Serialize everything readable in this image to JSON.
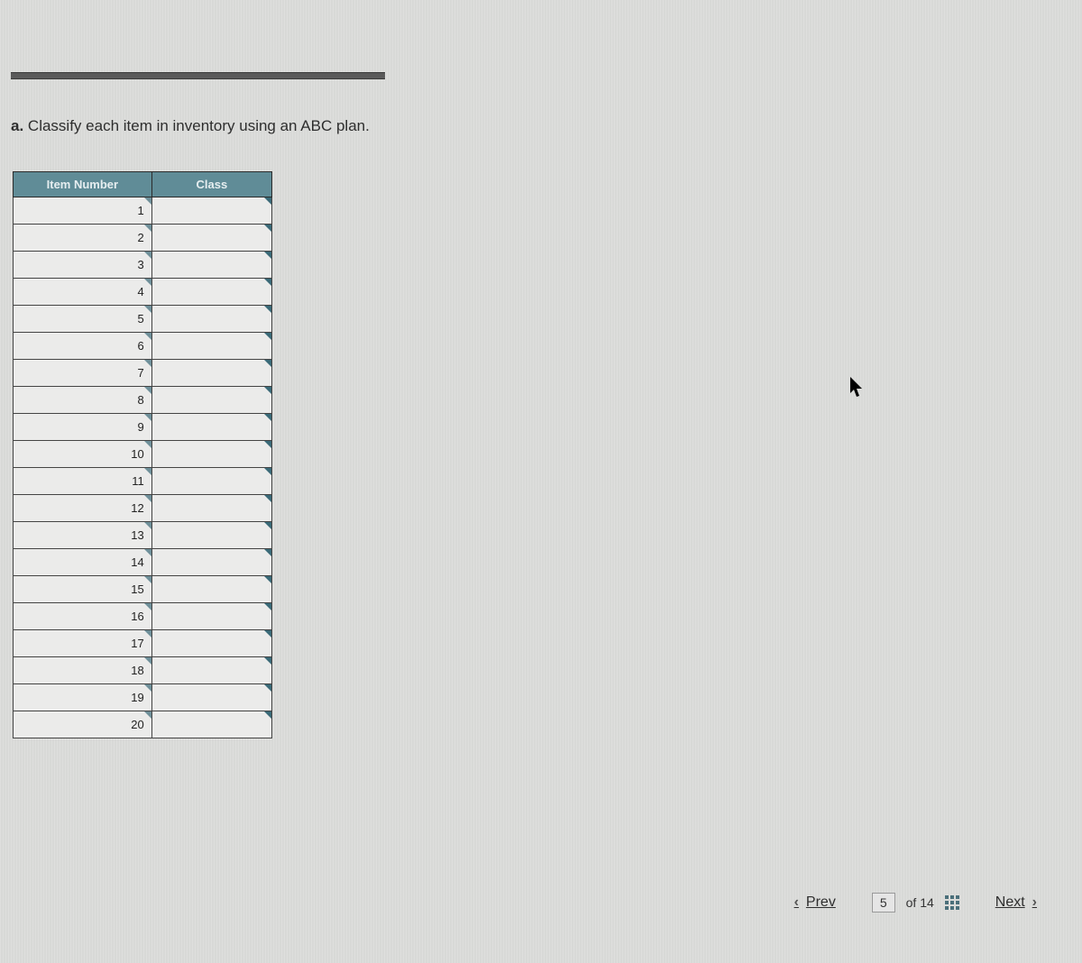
{
  "question": {
    "label": "a.",
    "text": "Classify each item in inventory using an ABC plan."
  },
  "table": {
    "headers": {
      "item": "Item Number",
      "class": "Class"
    },
    "rows": [
      {
        "item": "1",
        "class": ""
      },
      {
        "item": "2",
        "class": ""
      },
      {
        "item": "3",
        "class": ""
      },
      {
        "item": "4",
        "class": ""
      },
      {
        "item": "5",
        "class": ""
      },
      {
        "item": "6",
        "class": ""
      },
      {
        "item": "7",
        "class": ""
      },
      {
        "item": "8",
        "class": ""
      },
      {
        "item": "9",
        "class": ""
      },
      {
        "item": "10",
        "class": ""
      },
      {
        "item": "11",
        "class": ""
      },
      {
        "item": "12",
        "class": ""
      },
      {
        "item": "13",
        "class": ""
      },
      {
        "item": "14",
        "class": ""
      },
      {
        "item": "15",
        "class": ""
      },
      {
        "item": "16",
        "class": ""
      },
      {
        "item": "17",
        "class": ""
      },
      {
        "item": "18",
        "class": ""
      },
      {
        "item": "19",
        "class": ""
      },
      {
        "item": "20",
        "class": ""
      }
    ]
  },
  "nav": {
    "prev": "Prev",
    "next": "Next",
    "page_current": "5",
    "page_of": "of 14"
  }
}
